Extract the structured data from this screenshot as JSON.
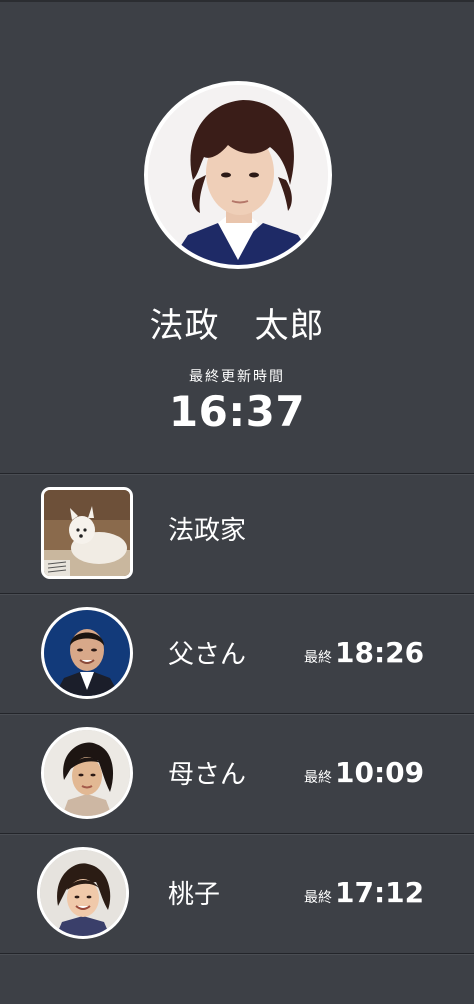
{
  "profile": {
    "name": "法政　太郎",
    "updated_label": "最終更新時間",
    "updated_time": "16:37",
    "avatar": "young-man-portrait"
  },
  "list": [
    {
      "name": "法政家",
      "avatar": "dog-photo",
      "shape": "square",
      "last_label": "",
      "last_time": ""
    },
    {
      "name": "父さん",
      "avatar": "man-portrait",
      "shape": "circle",
      "last_label": "最終",
      "last_time": "18:26"
    },
    {
      "name": "母さん",
      "avatar": "woman-portrait",
      "shape": "circle",
      "last_label": "最終",
      "last_time": "10:09"
    },
    {
      "name": "桃子",
      "avatar": "girl-portrait",
      "shape": "circle",
      "last_label": "最終",
      "last_time": "17:12"
    }
  ],
  "colors": {
    "background": "#3d4046",
    "divider": "#23252a",
    "text": "#ffffff"
  }
}
